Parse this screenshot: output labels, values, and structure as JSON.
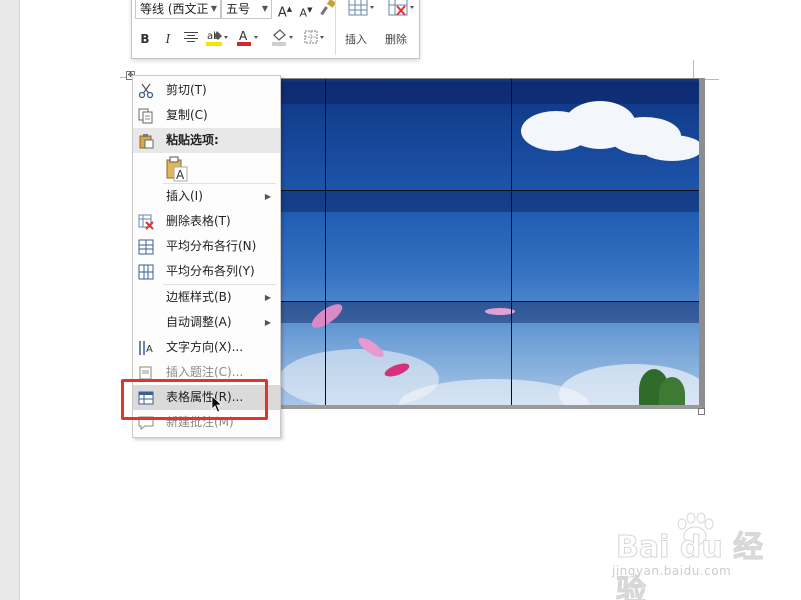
{
  "mini_toolbar": {
    "font_name": "等线 (西文正",
    "font_size": "五号",
    "grow_font": "A",
    "shrink_font": "A",
    "bold": "B",
    "italic": "I",
    "font_color_letter": "A",
    "insert_label": "插入",
    "delete_label": "删除"
  },
  "context_menu": {
    "items": [
      {
        "label": "剪切(T)",
        "icon": "scissors-icon"
      },
      {
        "label": "复制(C)",
        "icon": "copy-icon"
      },
      {
        "label": "粘贴选项:",
        "icon": "clipboard-icon"
      },
      {
        "label": "插入(I)",
        "icon": ""
      },
      {
        "label": "删除表格(T)",
        "icon": "delete-table-icon"
      },
      {
        "label": "平均分布各行(N)",
        "icon": "distribute-rows-icon"
      },
      {
        "label": "平均分布各列(Y)",
        "icon": "distribute-columns-icon"
      },
      {
        "label": "边框样式(B)",
        "icon": ""
      },
      {
        "label": "自动调整(A)",
        "icon": ""
      },
      {
        "label": "文字方向(X)...",
        "icon": "text-direction-icon"
      },
      {
        "label": "插入题注(C)...",
        "icon": "caption-icon"
      },
      {
        "label": "表格属性(R)...",
        "icon": "table-properties-icon"
      },
      {
        "label": "新建批注(M)",
        "icon": "comment-icon"
      }
    ],
    "paste_option_letter": "A"
  },
  "watermark": {
    "brand": "Bai du 经验",
    "url": "jingyan.baidu.com"
  },
  "colors": {
    "highlight": "#e0342d",
    "font_color": "#d22a2a",
    "highlighter": "#f2e500"
  }
}
